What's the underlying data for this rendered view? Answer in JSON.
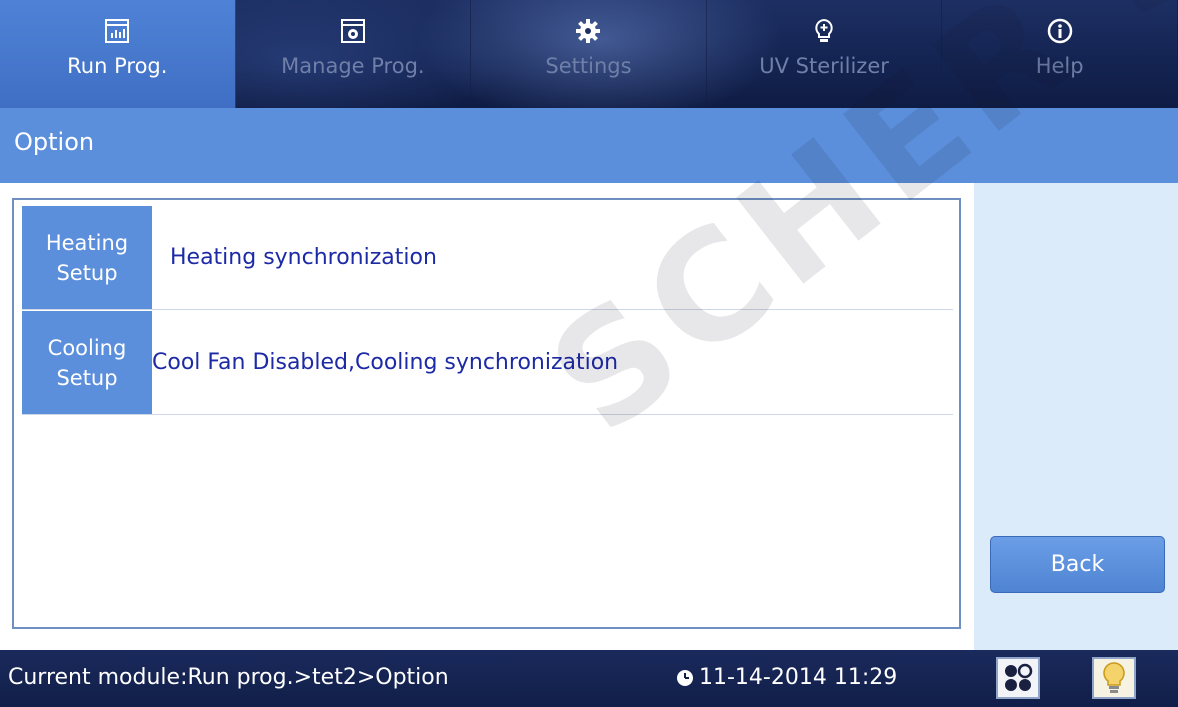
{
  "nav": {
    "tabs": [
      {
        "label": "Run Prog.",
        "icon": "chart-icon",
        "active": true
      },
      {
        "label": "Manage Prog.",
        "icon": "gear-box-icon",
        "active": false
      },
      {
        "label": "Settings",
        "icon": "gear-icon",
        "active": false
      },
      {
        "label": "UV Sterilizer",
        "icon": "bulb-plus-icon",
        "active": false
      },
      {
        "label": "Help",
        "icon": "info-icon",
        "active": false
      }
    ]
  },
  "page": {
    "title": "Option"
  },
  "options": [
    {
      "head_line1": "Heating",
      "head_line2": "Setup",
      "value": "Heating synchronization"
    },
    {
      "head_line1": "Cooling",
      "head_line2": "Setup",
      "value": "Cool Fan Disabled,Cooling synchronization"
    }
  ],
  "actions": {
    "back_label": "Back"
  },
  "status": {
    "module_text": "Current module:Run prog.>tet2>Option",
    "datetime": "11-14-2014 11:29",
    "buttons": [
      {
        "icon": "module-grid-icon"
      },
      {
        "icon": "lightbulb-icon"
      }
    ]
  },
  "watermark": "SCHER SA",
  "colors": {
    "accent": "#5b8fdc",
    "nav_bg": "#142452",
    "value_text": "#1c2aa6",
    "right_panel": "#dcebfa"
  }
}
